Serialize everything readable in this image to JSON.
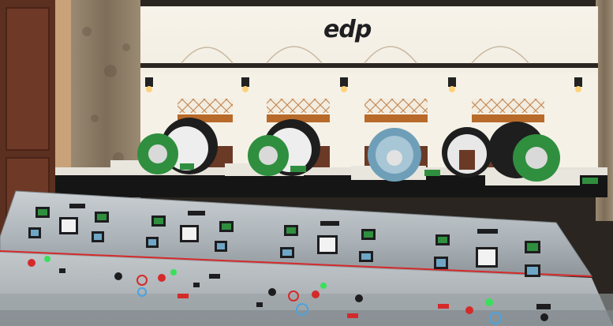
{
  "brand": {
    "logo_text": "edp"
  },
  "colors": {
    "wall": "#f4efe4",
    "ochre_band": "#b86a2a",
    "stone": "#8a7a66",
    "door": "#6b3a26",
    "console": "#b9c0c4",
    "console_dark": "#1d1d1f",
    "generator_green": "#2f8f3e",
    "generator_blue": "#6f9fb8",
    "accent_red": "#d42a2a",
    "led_green": "#39e05a"
  },
  "generators": [
    {
      "name": "generator-1",
      "color": "green"
    },
    {
      "name": "generator-2",
      "color": "green"
    },
    {
      "name": "generator-3",
      "color": "blue"
    },
    {
      "name": "generator-4",
      "color": "dark"
    },
    {
      "name": "generator-5",
      "color": "green"
    }
  ],
  "panel_groups": [
    {
      "name": "panel-group-1"
    },
    {
      "name": "panel-group-2"
    },
    {
      "name": "panel-group-3"
    },
    {
      "name": "panel-group-4"
    }
  ]
}
